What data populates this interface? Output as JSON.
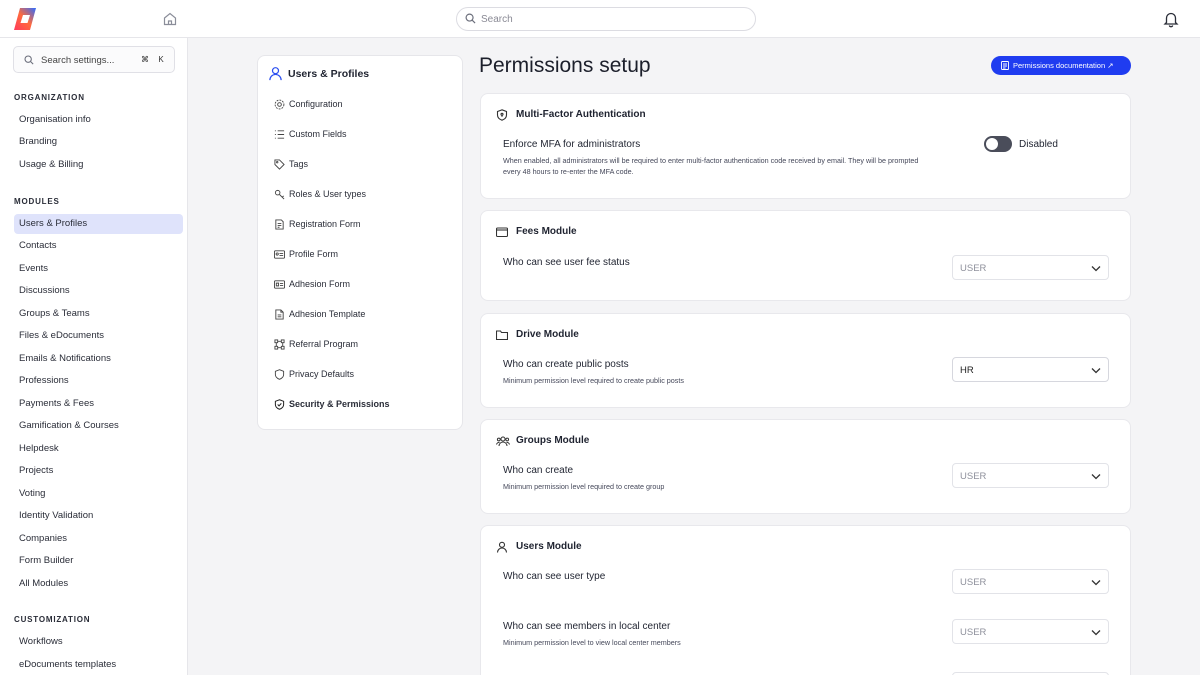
{
  "topbar": {
    "search_placeholder": "Search"
  },
  "sidebar": {
    "search_placeholder": "Search settings...",
    "shortcut_keys": [
      "⌘",
      "K"
    ],
    "sections": [
      {
        "title": "ORGANIZATION",
        "items": [
          "Organisation info",
          "Branding",
          "Usage & Billing"
        ]
      },
      {
        "title": "MODULES",
        "items": [
          "Users & Profiles",
          "Contacts",
          "Events",
          "Discussions",
          "Groups & Teams",
          "Files & eDocuments",
          "Emails & Notifications",
          "Professions",
          "Payments & Fees",
          "Gamification & Courses",
          "Helpdesk",
          "Projects",
          "Voting",
          "Identity Validation",
          "Companies",
          "Form Builder",
          "All Modules"
        ]
      },
      {
        "title": "CUSTOMIZATION",
        "items": [
          "Workflows",
          "eDocuments templates"
        ]
      }
    ],
    "active_item": "Users & Profiles"
  },
  "submenu": {
    "title": "Users & Profiles",
    "items": [
      {
        "label": "Configuration",
        "icon": "gear-icon"
      },
      {
        "label": "Custom Fields",
        "icon": "list-icon"
      },
      {
        "label": "Tags",
        "icon": "tag-icon"
      },
      {
        "label": "Roles & User types",
        "icon": "key-icon"
      },
      {
        "label": "Registration Form",
        "icon": "form-icon"
      },
      {
        "label": "Profile Form",
        "icon": "id-card-icon"
      },
      {
        "label": "Adhesion Form",
        "icon": "card-icon"
      },
      {
        "label": "Adhesion Template",
        "icon": "document-icon"
      },
      {
        "label": "Referral Program",
        "icon": "network-icon"
      },
      {
        "label": "Privacy Defaults",
        "icon": "shield-icon"
      },
      {
        "label": "Security & Permissions",
        "icon": "shield-check-icon"
      }
    ],
    "active_item": "Security & Permissions"
  },
  "main": {
    "title": "Permissions setup",
    "doc_button": "Permissions documentation ↗",
    "mfa": {
      "title": "Multi-Factor Authentication",
      "label": "Enforce MFA for administrators",
      "description_line1": "When enabled, all administrators will be required to enter multi-factor authentication code received by email. They will be prompted",
      "description_line2": "every 48 hours to re-enter the MFA code.",
      "toggle_state": "Disabled"
    },
    "fees": {
      "title": "Fees Module",
      "row1_label": "Who can see user fee status",
      "row1_value": "USER"
    },
    "drive": {
      "title": "Drive Module",
      "row1_label": "Who can create public posts",
      "row1_desc": "Minimum permission level required to create public posts",
      "row1_value": "HR"
    },
    "groups": {
      "title": "Groups Module",
      "row1_label": "Who can create",
      "row1_desc": "Minimum permission level required to create group",
      "row1_value": "USER"
    },
    "users": {
      "title": "Users Module",
      "row1_label": "Who can see user type",
      "row1_value": "USER",
      "row2_label": "Who can see members in local center",
      "row2_desc": "Minimum permission level to view local center members",
      "row2_value": "USER"
    }
  },
  "colors": {
    "accent": "#1f3cf0",
    "active_nav": "#dfe3fb",
    "toggle_off": "#4a4d5a"
  }
}
